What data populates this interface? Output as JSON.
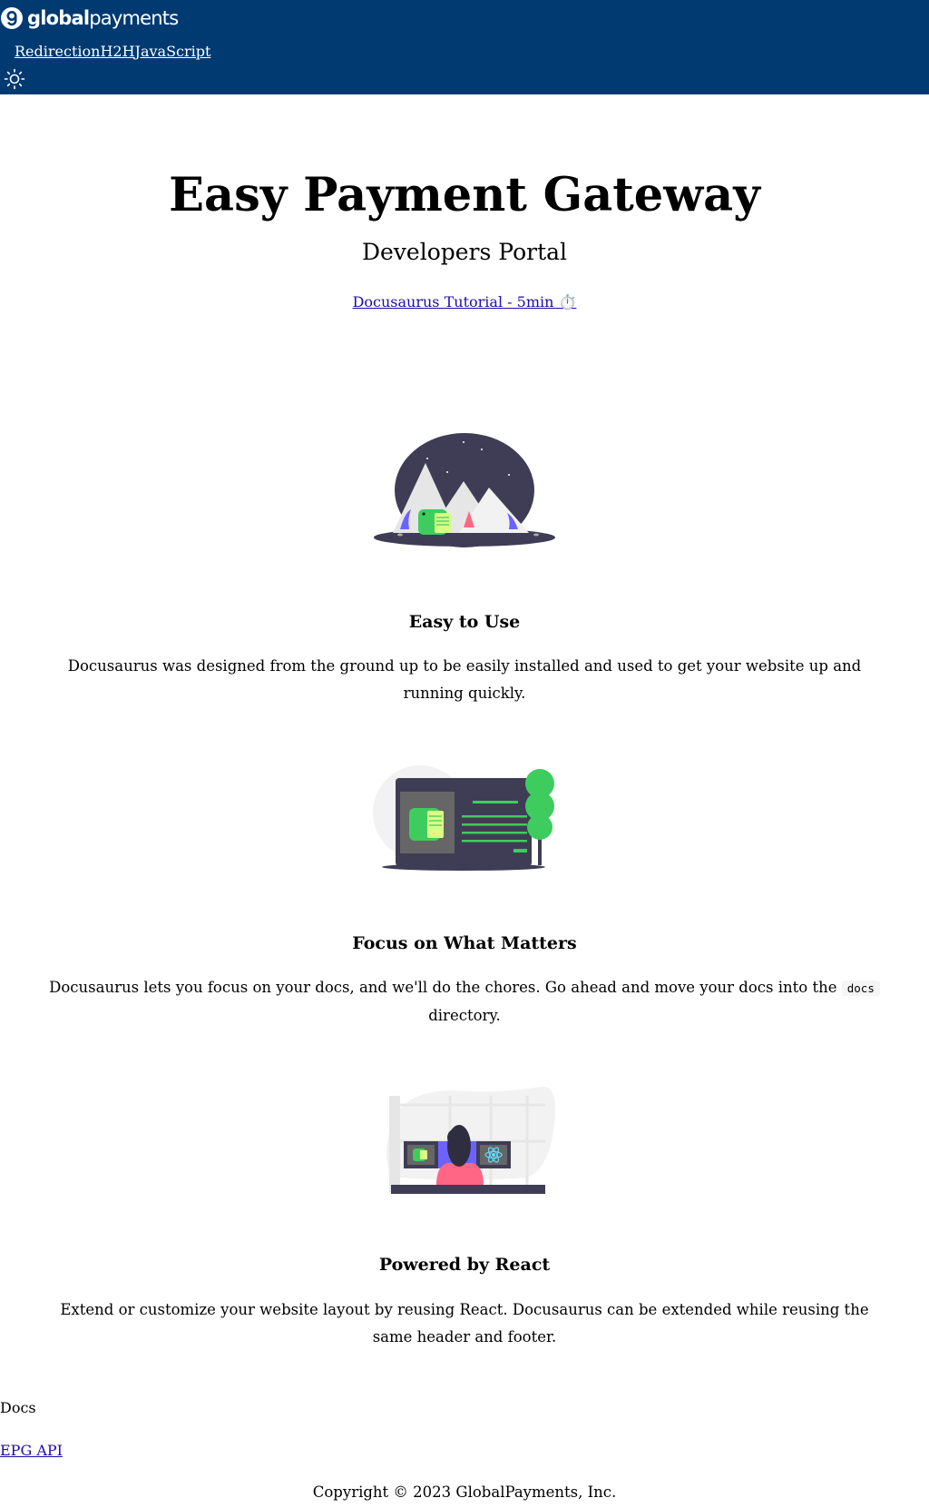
{
  "navbar": {
    "logo_bold": "global",
    "logo_light": "payments",
    "links": [
      "Redirection",
      "H2H",
      "JavaScript"
    ],
    "theme_icon": "sun-icon",
    "background": "#003a70"
  },
  "hero": {
    "title": "Easy Payment Gateway",
    "subtitle": "Developers Portal",
    "button": "Docusaurus Tutorial - 5min ⏱️"
  },
  "features": [
    {
      "title": "Easy to Use",
      "description": "Docusaurus was designed from the ground up to be easily installed and used to get your website up and running quickly.",
      "illustration": "mountain-illustration"
    },
    {
      "title": "Focus on What Matters",
      "description_before": "Docusaurus lets you focus on your docs, and we'll do the chores. Go ahead and move your docs into the",
      "code": "docs",
      "description_after": "directory.",
      "illustration": "tree-illustration"
    },
    {
      "title": "Powered by React",
      "description": "Extend or customize your website layout by reusing React. Docusaurus can be extended while reusing the same header and footer.",
      "illustration": "react-illustration"
    }
  ],
  "footer": {
    "section_title": "Docs",
    "link": "EPG API",
    "copyright": "Copyright © 2023 GlobalPayments, Inc."
  }
}
